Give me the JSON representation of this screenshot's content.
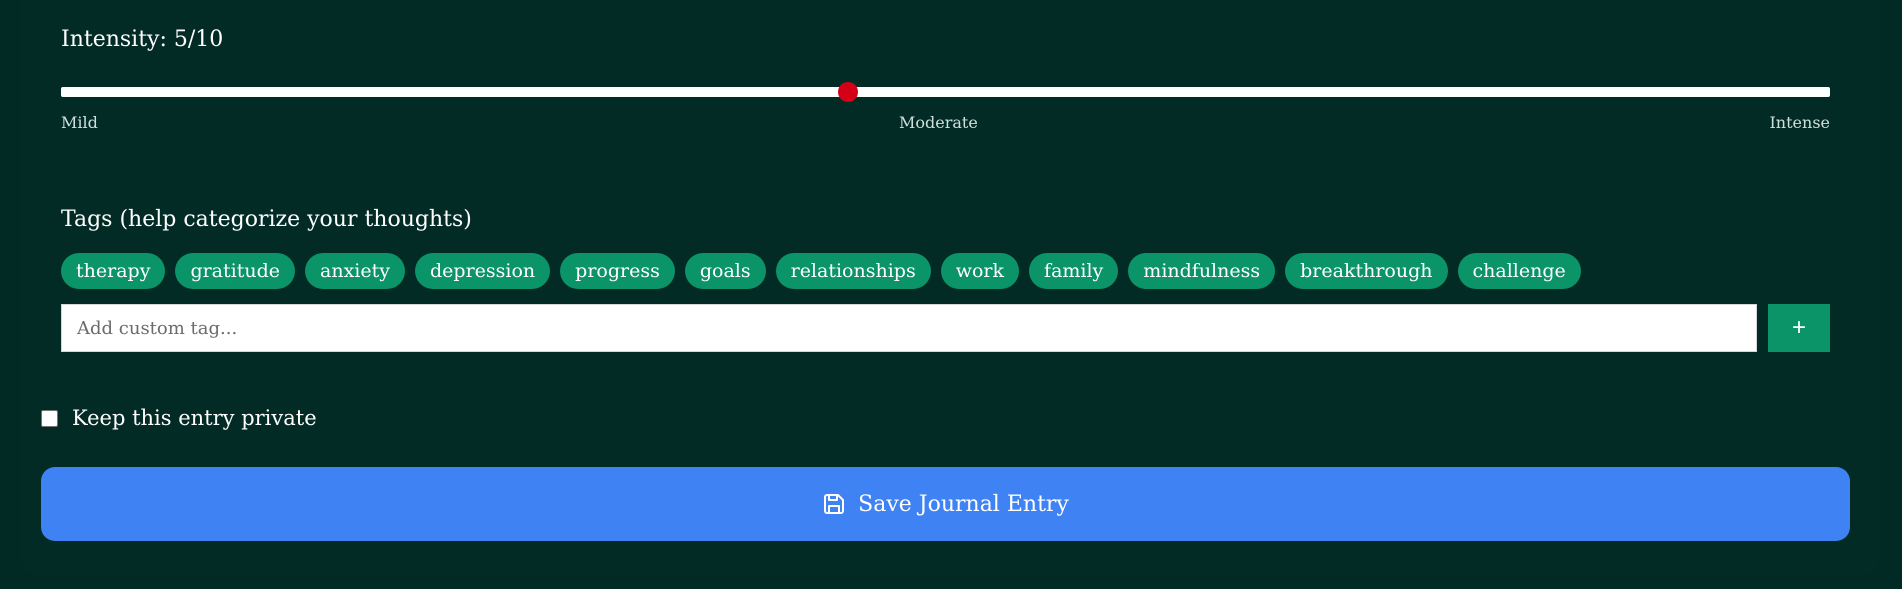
{
  "theme": {
    "background": "#022a24",
    "tag_color": "#0a9468",
    "slider_thumb_color": "#d40016",
    "save_button_color": "#3f82f4"
  },
  "intensity": {
    "label": "Intensity: 5/10",
    "value": 5,
    "min": 0,
    "max": 10,
    "scale_labels": {
      "min": "Mild",
      "mid": "Moderate",
      "max": "Intense"
    }
  },
  "tags": {
    "heading": "Tags (help categorize your thoughts)",
    "items": [
      "therapy",
      "gratitude",
      "anxiety",
      "depression",
      "progress",
      "goals",
      "relationships",
      "work",
      "family",
      "mindfulness",
      "breakthrough",
      "challenge"
    ],
    "custom_input_placeholder": "Add custom tag...",
    "add_button_label": "+"
  },
  "privacy": {
    "label": "Keep this entry private",
    "checked": false
  },
  "save": {
    "label": "Save Journal Entry",
    "icon": "save-icon"
  }
}
